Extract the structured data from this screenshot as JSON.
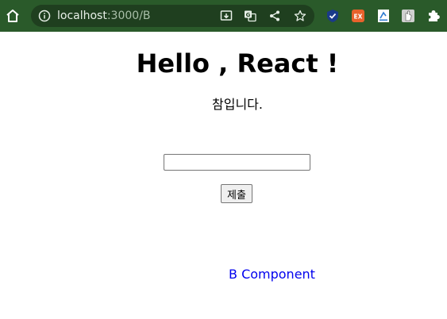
{
  "browser": {
    "url_host": "localhost",
    "url_path": ":3000/B",
    "toolbar_icons": [
      "home-icon",
      "info-icon",
      "install-app-icon",
      "translate-icon",
      "share-icon",
      "bookmark-star-icon"
    ],
    "extensions": [
      {
        "name": "check-extension-icon",
        "color": "#1a3a8a"
      },
      {
        "name": "ex-extension-icon",
        "label": "EX",
        "color": "#e8622c"
      },
      {
        "name": "doc-extension-icon",
        "color": "#ffffff"
      },
      {
        "name": "hand-extension-icon",
        "color": "#d0d0d0"
      },
      {
        "name": "puzzle-extensions-icon",
        "color": "#ffffff"
      }
    ]
  },
  "page": {
    "title": "Hello , React !",
    "subtitle": "참입니다.",
    "input_value": "",
    "submit_label": "제출",
    "link_text": "B Component"
  },
  "colors": {
    "browser_bar": "#2a5a2a",
    "link": "#0000ee"
  }
}
